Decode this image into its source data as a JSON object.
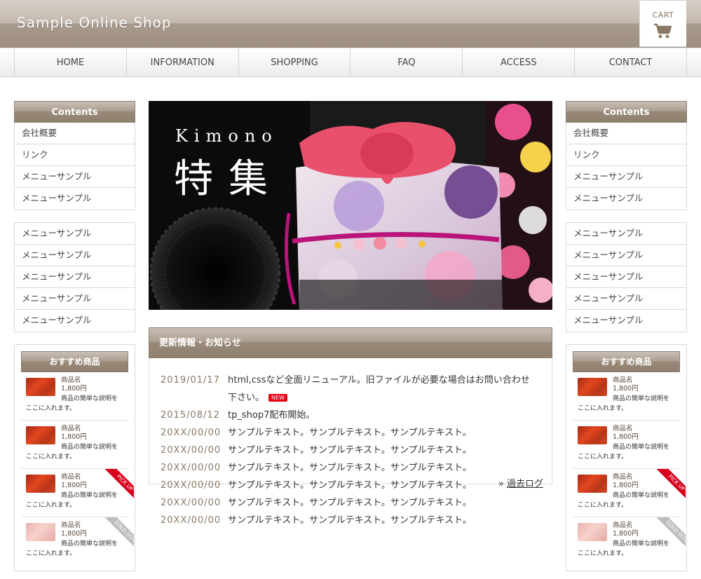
{
  "header": {
    "shop_name": "Sample Online Shop",
    "cart_label": "CART"
  },
  "nav": [
    "HOME",
    "INFORMATION",
    "SHOPPING",
    "FAQ",
    "ACCESS",
    "CONTACT"
  ],
  "sidebar": {
    "contents_title": "Contents",
    "menu1": [
      "会社概要",
      "リンク",
      "メニューサンプル",
      "メニューサンプル"
    ],
    "menu2": [
      "メニューサンプル",
      "メニューサンプル",
      "メニューサンプル",
      "メニューサンプル",
      "メニューサンプル"
    ],
    "recommend_title": "おすすめ商品",
    "products": [
      {
        "name": "商品名",
        "price": "1,800円",
        "desc_a": "商品の簡単な説明を",
        "desc_b": "ここに入れます。",
        "ribbon": ""
      },
      {
        "name": "商品名",
        "price": "1,800円",
        "desc_a": "商品の簡単な説明を",
        "desc_b": "ここに入れます。",
        "ribbon": ""
      },
      {
        "name": "商品名",
        "price": "1,800円",
        "desc_a": "商品の簡単な説明を",
        "desc_b": "ここに入れます。",
        "ribbon": "PICK UP"
      },
      {
        "name": "商品名",
        "price": "1,800円",
        "desc_a": "商品の簡単な説明を",
        "desc_b": "ここに入れます。",
        "ribbon": "SOLD OUT"
      }
    ]
  },
  "hero": {
    "title_en": "Kimono",
    "title_jp": "特集"
  },
  "news": {
    "title": "更新情報・お知らせ",
    "items": [
      {
        "date": "2019/01/17",
        "text": "html,cssなど全面リニューアル。旧ファイルが必要な場合はお問い合わせ下さい。",
        "badge": "NEW"
      },
      {
        "date": "2015/08/12",
        "text": "tp_shop7配布開始。"
      },
      {
        "date": "20XX/00/00",
        "text": "サンプルテキスト。サンプルテキスト。サンプルテキスト。"
      },
      {
        "date": "20XX/00/00",
        "text": "サンプルテキスト。サンプルテキスト。サンプルテキスト。"
      },
      {
        "date": "20XX/00/00",
        "text": "サンプルテキスト。サンプルテキスト。サンプルテキスト。"
      },
      {
        "date": "20XX/00/00",
        "text": "サンプルテキスト。サンプルテキスト。サンプルテキスト。"
      },
      {
        "date": "20XX/00/00",
        "text": "サンプルテキスト。サンプルテキスト。サンプルテキスト。"
      },
      {
        "date": "20XX/00/00",
        "text": "サンプルテキスト。サンプルテキスト。サンプルテキスト。"
      }
    ],
    "more_prefix": "»",
    "more_label": "過去ログ"
  },
  "colors": {
    "brand_brown": "#9e8f80",
    "date_color": "#8a7866",
    "new_badge": "#e60012",
    "pickup_ribbon": "#d8001c"
  },
  "icons": {
    "cart": "cart-icon"
  }
}
